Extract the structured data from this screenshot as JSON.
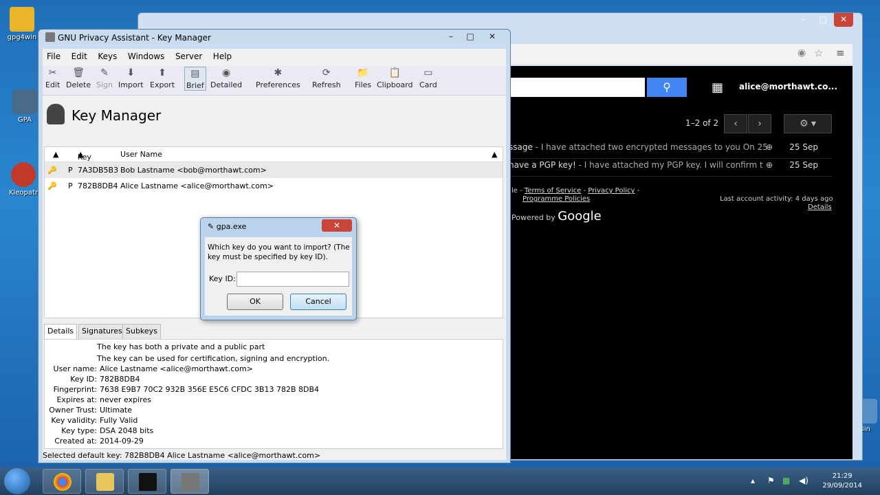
{
  "desktop": {
    "icons": [
      {
        "label": "gpg4win"
      },
      {
        "label": "GPA"
      },
      {
        "label": "Kleopatr"
      },
      {
        "label": "Bin"
      }
    ]
  },
  "gmail": {
    "search_icon": "search-icon",
    "user": "alice@morthawt.co...",
    "count": "1–2 of 2",
    "rows": [
      {
        "subject": "ssage",
        "snippet": " - I have attached two encrypted messages to you On 25",
        "date": "25 Sep"
      },
      {
        "subject": "have a PGP key!",
        "snippet": " - I have attached my PGP key. I will confirm t",
        "date": "25 Sep"
      }
    ],
    "footer": {
      "prefix": "le - ",
      "terms": "Terms of Service",
      "sep": " - ",
      "privacy": "Privacy Policy",
      "sep2": " -",
      "programme": "Programme Policies",
      "powered": "Powered by",
      "google": "Google",
      "last_activity": "Last account activity: 4 days ago",
      "details": "Details"
    }
  },
  "gpa": {
    "title": "GNU Privacy Assistant - Key Manager",
    "menu": [
      "File",
      "Edit",
      "Keys",
      "Windows",
      "Server",
      "Help"
    ],
    "toolbar": [
      {
        "label": "Edit",
        "icon": "✂"
      },
      {
        "label": "Delete",
        "icon": "🗑"
      },
      {
        "label": "Sign",
        "icon": "✎"
      },
      {
        "label": "Import",
        "icon": "⬇"
      },
      {
        "label": "Export",
        "icon": "⬆"
      },
      {
        "label": "Brief",
        "icon": "▤"
      },
      {
        "label": "Detailed",
        "icon": "◉"
      },
      {
        "label": "Preferences",
        "icon": "✱"
      },
      {
        "label": "Refresh",
        "icon": "⟳"
      },
      {
        "label": "Files",
        "icon": "📁"
      },
      {
        "label": "Clipboard",
        "icon": "📋"
      },
      {
        "label": "Card",
        "icon": "▭"
      }
    ],
    "heading": "Key Manager",
    "columns": {
      "keyid": "Key ID",
      "username": "User Name"
    },
    "keys": [
      {
        "type": "P",
        "keyid": "7A3DB5B3",
        "user": "Bob Lastname <bob@morthawt.com>"
      },
      {
        "type": "P",
        "keyid": "782B8DB4",
        "user": "Alice Lastname <alice@morthawt.com>"
      }
    ],
    "tabs": [
      "Details",
      "Signatures",
      "Subkeys"
    ],
    "details": {
      "line1": "The key has both a private and a public part",
      "line2": "The key can be used for certification, signing and encryption.",
      "fields": [
        {
          "label": "User name:",
          "value": "Alice Lastname <alice@morthawt.com>"
        },
        {
          "label": "Key ID:",
          "value": "782B8DB4"
        },
        {
          "label": "Fingerprint:",
          "value": "7638 E9B7 70C2 932B 356E  E5C6 CFDC 3B13 782B 8DB4"
        },
        {
          "label": "Expires at:",
          "value": "never expires"
        },
        {
          "label": "Owner Trust:",
          "value": "Ultimate"
        },
        {
          "label": "Key validity:",
          "value": "Fully Valid"
        },
        {
          "label": "Key type:",
          "value": "DSA 2048 bits"
        },
        {
          "label": "Created at:",
          "value": "2014-09-29"
        }
      ]
    },
    "status": "Selected default key:  782B8DB4  Alice Lastname <alice@morthawt.com>"
  },
  "dialog": {
    "title": "gpa.exe",
    "message": "Which key do you want to import? (The key must be specified by key ID).",
    "label": "Key ID:",
    "input_value": "",
    "ok": "OK",
    "cancel": "Cancel"
  },
  "taskbar": {
    "time": "21:29",
    "date": "29/09/2014"
  }
}
